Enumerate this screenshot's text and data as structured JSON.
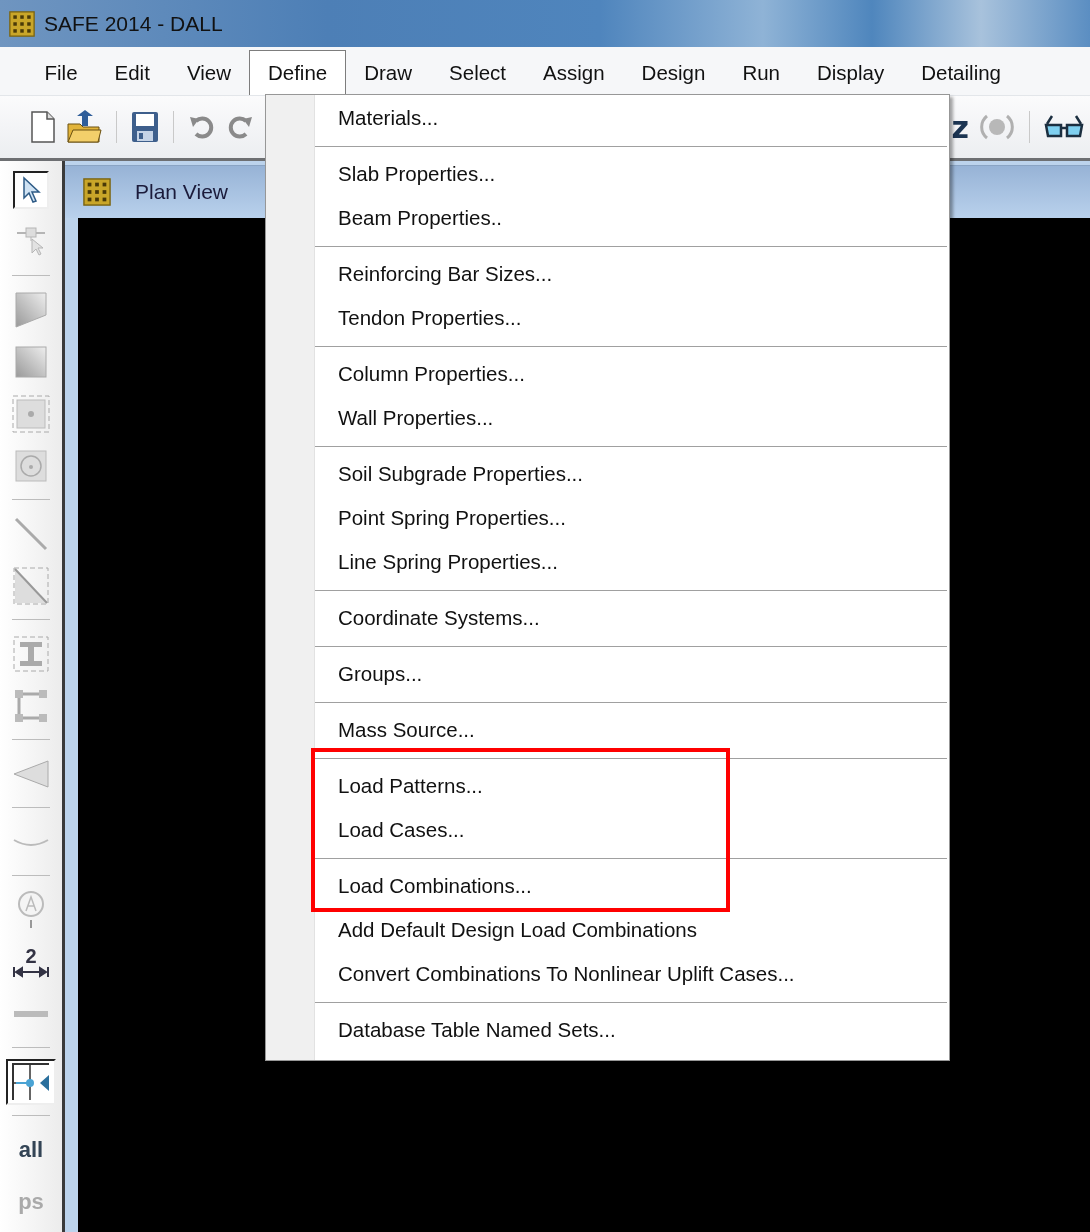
{
  "window": {
    "title": "SAFE 2014 - DALL"
  },
  "menu_bar": [
    {
      "label": "File",
      "selected": false
    },
    {
      "label": "Edit",
      "selected": false
    },
    {
      "label": "View",
      "selected": false
    },
    {
      "label": "Define",
      "selected": true
    },
    {
      "label": "Draw",
      "selected": false
    },
    {
      "label": "Select",
      "selected": false
    },
    {
      "label": "Assign",
      "selected": false
    },
    {
      "label": "Design",
      "selected": false
    },
    {
      "label": "Run",
      "selected": false
    },
    {
      "label": "Display",
      "selected": false
    },
    {
      "label": "Detailing",
      "selected": false
    }
  ],
  "toolbar": {
    "left": [
      {
        "kind": "icon"
      },
      {
        "kind": "icon"
      },
      {
        "kind": "separator"
      },
      {
        "kind": "icon"
      },
      {
        "kind": "separator"
      },
      {
        "kind": "icon"
      },
      {
        "kind": "icon"
      }
    ],
    "right": [
      {
        "kind": "text",
        "label": "z"
      },
      {
        "kind": "icon"
      },
      {
        "kind": "separator"
      },
      {
        "kind": "icon"
      }
    ]
  },
  "left_toolbar": [
    {
      "kind": "tool",
      "selected": true
    },
    {
      "kind": "tool",
      "selected": false
    },
    {
      "kind": "separator"
    },
    {
      "kind": "tool",
      "selected": false
    },
    {
      "kind": "tool",
      "selected": false
    },
    {
      "kind": "tool",
      "selected": false
    },
    {
      "kind": "tool",
      "selected": false
    },
    {
      "kind": "separator"
    },
    {
      "kind": "tool",
      "selected": false
    },
    {
      "kind": "tool",
      "selected": false
    },
    {
      "kind": "separator"
    },
    {
      "kind": "tool",
      "selected": false
    },
    {
      "kind": "tool",
      "selected": false
    },
    {
      "kind": "separator"
    },
    {
      "kind": "tool",
      "selected": false
    },
    {
      "kind": "separator"
    },
    {
      "kind": "tool",
      "selected": false
    },
    {
      "kind": "separator"
    },
    {
      "kind": "tool",
      "selected": false
    },
    {
      "kind": "dimension",
      "label": "2"
    },
    {
      "kind": "tool",
      "selected": false
    },
    {
      "kind": "separator"
    },
    {
      "kind": "tool",
      "selected": true
    },
    {
      "kind": "separator"
    },
    {
      "kind": "text",
      "label": "all",
      "disabled": false
    },
    {
      "kind": "text",
      "label": "ps",
      "disabled": true
    }
  ],
  "plan_view": {
    "title": "Plan View"
  },
  "define_menu": [
    {
      "kind": "item",
      "label": "Materials...",
      "highlighted": false
    },
    {
      "kind": "separator",
      "highlighted": false
    },
    {
      "kind": "item",
      "label": "Slab Properties...",
      "highlighted": false
    },
    {
      "kind": "item",
      "label": "Beam Properties..",
      "highlighted": false
    },
    {
      "kind": "separator",
      "highlighted": false
    },
    {
      "kind": "item",
      "label": "Reinforcing Bar Sizes...",
      "highlighted": false
    },
    {
      "kind": "item",
      "label": "Tendon Properties...",
      "highlighted": false
    },
    {
      "kind": "separator",
      "highlighted": false
    },
    {
      "kind": "item",
      "label": "Column Properties...",
      "highlighted": false
    },
    {
      "kind": "item",
      "label": "Wall Properties...",
      "highlighted": false
    },
    {
      "kind": "separator",
      "highlighted": false
    },
    {
      "kind": "item",
      "label": "Soil Subgrade Properties...",
      "highlighted": false
    },
    {
      "kind": "item",
      "label": "Point Spring Properties...",
      "highlighted": false
    },
    {
      "kind": "item",
      "label": "Line Spring Properties...",
      "highlighted": false
    },
    {
      "kind": "separator",
      "highlighted": false
    },
    {
      "kind": "item",
      "label": "Coordinate Systems...",
      "highlighted": false
    },
    {
      "kind": "separator",
      "highlighted": false
    },
    {
      "kind": "item",
      "label": "Groups...",
      "highlighted": false
    },
    {
      "kind": "separator",
      "highlighted": false
    },
    {
      "kind": "item",
      "label": "Mass Source...",
      "highlighted": false
    },
    {
      "kind": "separator",
      "highlighted": true
    },
    {
      "kind": "item",
      "label": "Load Patterns...",
      "highlighted": true
    },
    {
      "kind": "item",
      "label": "Load Cases...",
      "highlighted": true
    },
    {
      "kind": "separator",
      "highlighted": true
    },
    {
      "kind": "item",
      "label": "Load Combinations...",
      "highlighted": true
    },
    {
      "kind": "item",
      "label": "Add Default Design Load Combinations",
      "highlighted": false
    },
    {
      "kind": "item",
      "label": "Convert Combinations To Nonlinear Uplift Cases...",
      "highlighted": false
    },
    {
      "kind": "separator",
      "highlighted": false
    },
    {
      "kind": "item",
      "label": "Database Table Named Sets...",
      "highlighted": false
    }
  ]
}
